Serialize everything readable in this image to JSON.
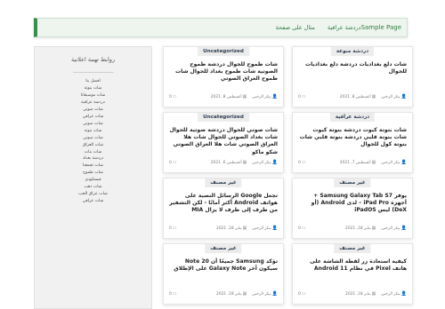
{
  "nav": {
    "items": [
      "Sample Page",
      "دردشة عراقية",
      "مثال على صفحة"
    ]
  },
  "sidebar": {
    "title": "روابط تهمة اعلانية",
    "links": [
      "افضل بنا",
      "شات بنوتة",
      "شات موسيقانا",
      "دردشة عراقية",
      "شات صوتي",
      "شات عراقي",
      "شات صوتي",
      "شات بنوته",
      "شات صوتي",
      "شات العراق",
      "شات بنات",
      "دردشة بغداد",
      "شات تجمعنا",
      "شات طموح",
      "فيسكودي",
      "شات ذهب",
      "شات عراق الحب",
      "شات عراقي"
    ]
  },
  "cards": [
    {
      "cat": "دردشة منوعة",
      "title": "شات دلع بغداديات دردشة دلع بغداديات للجوال",
      "author": "بيكر الرحبي",
      "date": "أغسطس 8, 2021",
      "comments": "0"
    },
    {
      "cat": "Uncategorized",
      "title": "شات طموح للجوال دردشة طموح الصوتية شات طموح بغداد للجوال شات طموح العراق الصوتي",
      "author": "بيكر الرحبي",
      "date": "أغسطس 8, 2021",
      "comments": "0"
    },
    {
      "cat": "دردشة عراقية",
      "title": "شات بنوتة كيوت دردشة بنوتة كيوت شات بنوتة قلبي دردشة بنوتة قلبي شات بنوتة كول للجوال",
      "author": "بيكر الرحبي",
      "date": "أغسطس 7, 2021",
      "comments": "0"
    },
    {
      "cat": "Uncategorized",
      "title": "شات صوتي للجوال دردشة صوتية للجوال شات بغداد الصوتي للجوال شات هلا العراق الصوتي شات هلا العراق الصوتي شكو ماكو",
      "author": "بيكر الرحبي",
      "date": "أغسطس 6, 2021",
      "comments": "0"
    },
    {
      "cat": "غير مصنف",
      "title": "يوفر Samsung Galaxy Tab S7 + أجهزة iPad Pro – لدى Android (أو DeX) ليس iPadOS",
      "author": "بيكر الرحبي",
      "date": "يناير 18, 2021",
      "comments": "0"
    },
    {
      "cat": "غير مصنف",
      "title": "تجعل Google الرسائل النصية على هواتف Android أكثر أمانًا - لكن التشفير من طرف إلى طرف لا يزال MIA",
      "author": "بيكر الرحبي",
      "date": "يناير 18, 2021",
      "comments": "0"
    },
    {
      "cat": "غير مصنف",
      "title": "كيفية استعادة زر لقطة الشاشة على هاتف Pixel في نظام Android 11",
      "author": "بيكر الرحبي",
      "date": "يناير 18, 2021",
      "comments": "0"
    },
    {
      "cat": "غير مصنف",
      "title": "تؤكد Samsung جميعًا أن Note 20 سيكون آخر Galaxy Note على الإطلاق",
      "author": "بيكر الرحبي",
      "date": "يناير 18, 2021",
      "comments": "0"
    }
  ]
}
